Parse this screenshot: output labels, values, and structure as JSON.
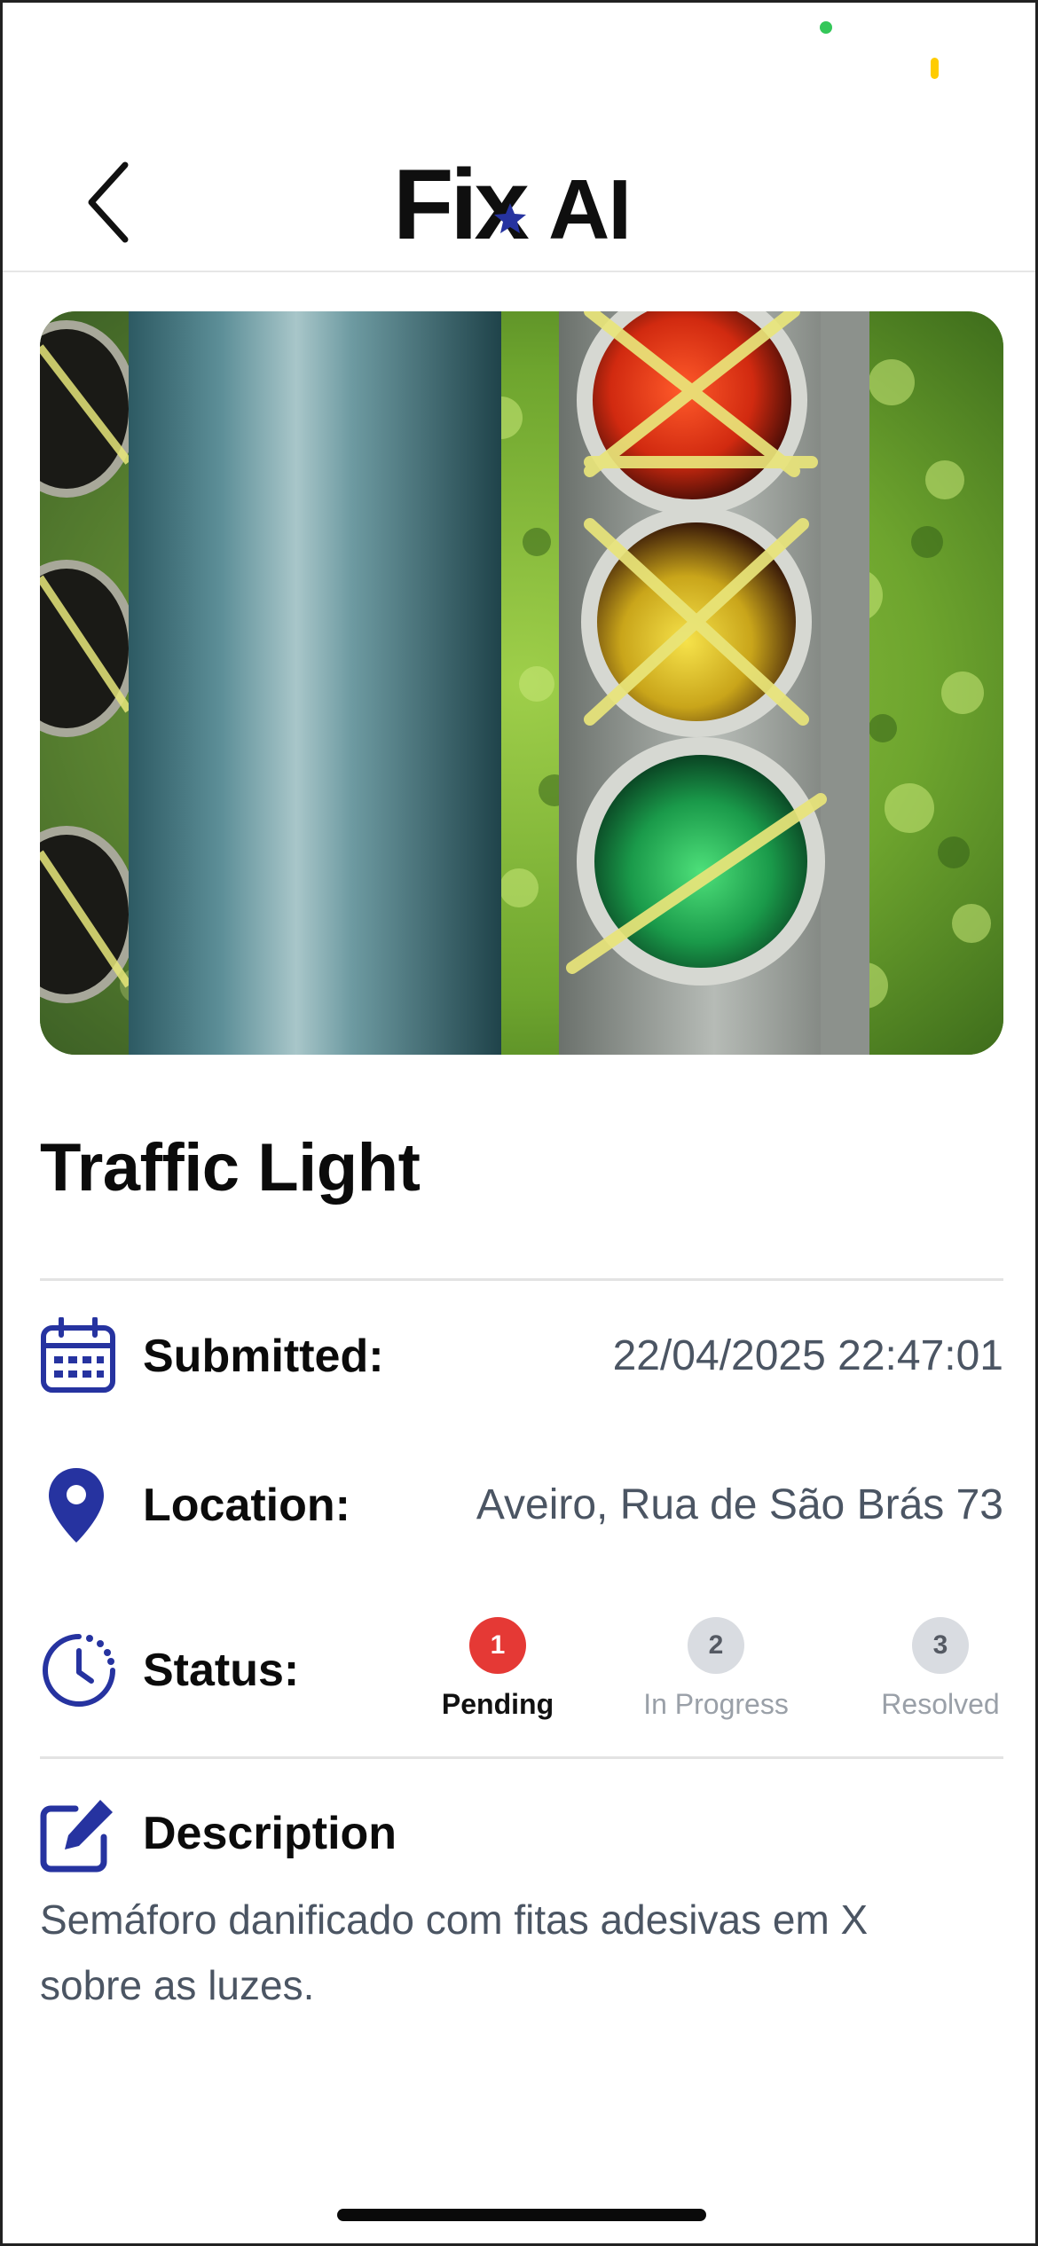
{
  "header": {
    "logo_text_part1": "Fix",
    "logo_text_part2": "AI"
  },
  "report": {
    "title": "Traffic Light",
    "submitted_label": "Submitted:",
    "submitted_value": "22/04/2025 22:47:01",
    "location_label": "Location:",
    "location_value": "Aveiro, Rua de São Brás 73",
    "status_label": "Status:",
    "status_steps": [
      {
        "number": "1",
        "label": "Pending",
        "state": "active"
      },
      {
        "number": "2",
        "label": "In Progress",
        "state": "inactive"
      },
      {
        "number": "3",
        "label": "Resolved",
        "state": "inactive"
      }
    ],
    "description_label": "Description",
    "description_text": "Semáforo danificado com fitas adesivas em X sobre as luzes."
  },
  "colors": {
    "accent": "#2633a0",
    "pending": "#e53935",
    "inactive_step": "#d9dce1"
  },
  "icons": {
    "back": "chevron-left-icon",
    "submitted": "calendar-icon",
    "location": "map-pin-icon",
    "status": "clock-progress-icon",
    "description": "edit-icon"
  }
}
